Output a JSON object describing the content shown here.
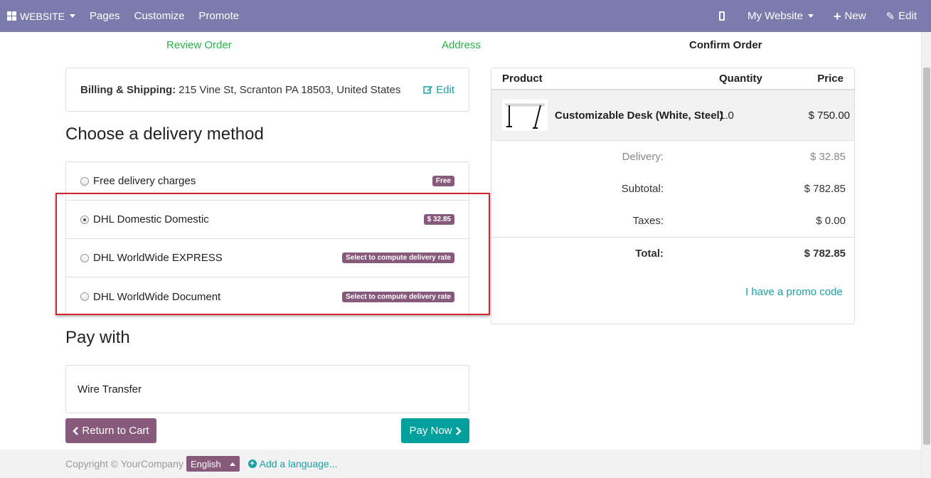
{
  "topbar": {
    "brand": "WEBSITE",
    "menu": [
      "Pages",
      "Customize",
      "Promote"
    ],
    "site_selector": "My Website",
    "new_label": "New",
    "edit_label": "Edit"
  },
  "steps": {
    "review": "Review Order",
    "address": "Address",
    "confirm": "Confirm Order"
  },
  "address": {
    "label": "Billing & Shipping:",
    "value": "215 Vine St, Scranton PA 18503, United States",
    "edit": "Edit"
  },
  "delivery": {
    "heading": "Choose a delivery method",
    "methods": [
      {
        "name": "Free delivery charges",
        "badge": "Free",
        "checked": false
      },
      {
        "name": "DHL Domestic Domestic",
        "badge": "$ 32.85",
        "checked": true
      },
      {
        "name": "DHL WorldWide EXPRESS",
        "badge": "Select to compute delivery rate",
        "checked": false
      },
      {
        "name": "DHL WorldWide Document",
        "badge": "Select to compute delivery rate",
        "checked": false
      }
    ]
  },
  "payment": {
    "heading": "Pay with",
    "method": "Wire Transfer"
  },
  "buttons": {
    "return": "Return to Cart",
    "pay": "Pay Now"
  },
  "footer": {
    "copyright": "Copyright © YourCompany",
    "language": "English",
    "add_language": "Add a language..."
  },
  "summary": {
    "headers": {
      "product": "Product",
      "quantity": "Quantity",
      "price": "Price"
    },
    "line": {
      "name": "Customizable Desk (White, Steel)",
      "qty": "1.0",
      "price": "$ 750.00"
    },
    "delivery_label": "Delivery:",
    "delivery_value": "$ 32.85",
    "subtotal_label": "Subtotal:",
    "subtotal_value": "$ 782.85",
    "taxes_label": "Taxes:",
    "taxes_value": "$ 0.00",
    "total_label": "Total:",
    "total_value": "$ 782.85",
    "promo": "I have a promo code"
  },
  "colors": {
    "topbar": "#7c7bad",
    "brand": "#875a7b",
    "teal": "#00a09d",
    "step_done": "#2ab24a",
    "highlight": "#d0262d"
  }
}
